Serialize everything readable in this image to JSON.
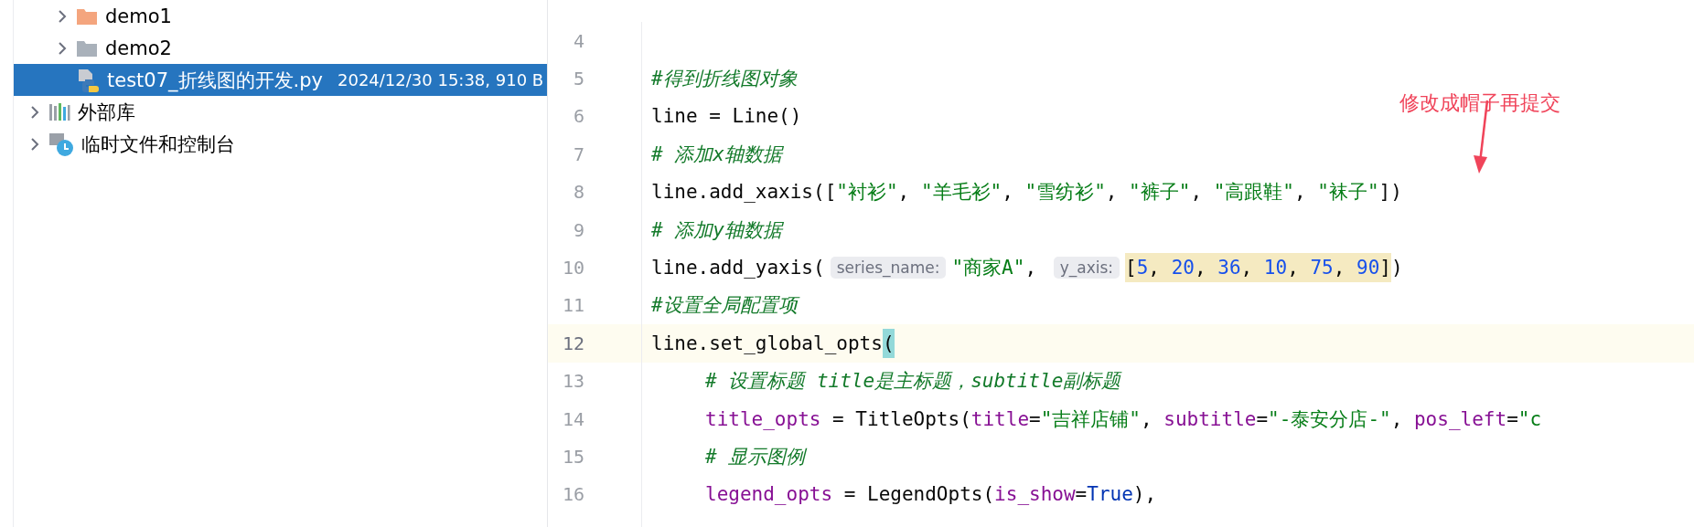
{
  "project_tree": {
    "nested_items": [
      {
        "label": "demo1",
        "kind": "folder",
        "color": "#f4a57e",
        "expanded": false,
        "selected": false
      },
      {
        "label": "demo2",
        "kind": "folder",
        "color": "#a9b1ba",
        "expanded": false,
        "selected": false
      },
      {
        "label": "test07_折线图的开发.py",
        "kind": "python-file",
        "meta": "2024/12/30 15:38, 910 B",
        "selected": true
      }
    ],
    "items": [
      {
        "label": "外部库",
        "kind": "library",
        "expanded": false,
        "selected": false
      },
      {
        "label": "临时文件和控制台",
        "kind": "scratch",
        "expanded": false,
        "selected": false
      }
    ]
  },
  "editor": {
    "lines": [
      {
        "number": "4",
        "current": false
      },
      {
        "number": "5",
        "current": false,
        "tokens": [
          {
            "kind": "comment",
            "text": "#得到折线图对象"
          }
        ]
      },
      {
        "number": "6",
        "current": false,
        "tokens": [
          {
            "kind": "plain",
            "text": "line = Line()"
          }
        ]
      },
      {
        "number": "7",
        "current": false,
        "tokens": [
          {
            "kind": "comment",
            "text": "# 添加x轴数据"
          }
        ]
      },
      {
        "number": "8",
        "current": false,
        "tokens": [
          {
            "kind": "plain",
            "text": "line.add_xaxis(["
          },
          {
            "kind": "string",
            "text": "\"衬衫\""
          },
          {
            "kind": "plain",
            "text": ", "
          },
          {
            "kind": "string",
            "text": "\"羊毛衫\""
          },
          {
            "kind": "plain",
            "text": ", "
          },
          {
            "kind": "string",
            "text": "\"雪纺衫\""
          },
          {
            "kind": "plain",
            "text": ", "
          },
          {
            "kind": "string",
            "text": "\"裤子\""
          },
          {
            "kind": "plain",
            "text": ", "
          },
          {
            "kind": "string",
            "text": "\"高跟鞋\""
          },
          {
            "kind": "plain",
            "text": ", "
          },
          {
            "kind": "string",
            "text": "\"袜子\""
          },
          {
            "kind": "plain",
            "text": "])"
          }
        ]
      },
      {
        "number": "9",
        "current": false,
        "tokens": [
          {
            "kind": "comment",
            "text": "# 添加y轴数据"
          }
        ]
      },
      {
        "number": "10",
        "current": false,
        "tokens": [
          {
            "kind": "plain",
            "text": "line.add_yaxis("
          },
          {
            "kind": "hint",
            "text": "series_name:"
          },
          {
            "kind": "string",
            "text": "\"商家A\""
          },
          {
            "kind": "plain",
            "text": ", "
          },
          {
            "kind": "hint",
            "text": "y_axis:"
          },
          {
            "kind": "selection",
            "tokens": [
              {
                "kind": "plain",
                "text": "["
              },
              {
                "kind": "number",
                "text": "5"
              },
              {
                "kind": "plain",
                "text": ", "
              },
              {
                "kind": "number",
                "text": "20"
              },
              {
                "kind": "plain",
                "text": ", "
              },
              {
                "kind": "number",
                "text": "36"
              },
              {
                "kind": "plain",
                "text": ", "
              },
              {
                "kind": "number",
                "text": "10"
              },
              {
                "kind": "plain",
                "text": ", "
              },
              {
                "kind": "number",
                "text": "75"
              },
              {
                "kind": "plain",
                "text": ", "
              },
              {
                "kind": "number",
                "text": "90"
              },
              {
                "kind": "plain",
                "text": "]"
              }
            ]
          },
          {
            "kind": "plain",
            "text": ")"
          }
        ]
      },
      {
        "number": "11",
        "current": false,
        "tokens": [
          {
            "kind": "comment",
            "text": "#设置全局配置项"
          }
        ]
      },
      {
        "number": "12",
        "current": true,
        "tokens": [
          {
            "kind": "plain",
            "text": "line.set_global_opts"
          },
          {
            "kind": "matched-paren",
            "text": "("
          }
        ],
        "children": [
          {
            "number": "13",
            "current": false,
            "tokens": [
              {
                "kind": "comment",
                "text": "# 设置标题 title是主标题，subtitle副标题"
              }
            ]
          },
          {
            "number": "14",
            "current": false,
            "tokens": [
              {
                "kind": "param",
                "text": "title_opts"
              },
              {
                "kind": "plain",
                "text": " = TitleOpts("
              },
              {
                "kind": "param",
                "text": "title"
              },
              {
                "kind": "plain",
                "text": "="
              },
              {
                "kind": "string",
                "text": "\"吉祥店铺\""
              },
              {
                "kind": "plain",
                "text": ", "
              },
              {
                "kind": "param",
                "text": "subtitle"
              },
              {
                "kind": "plain",
                "text": "="
              },
              {
                "kind": "string",
                "text": "\"-泰安分店-\""
              },
              {
                "kind": "plain",
                "text": ", "
              },
              {
                "kind": "param",
                "text": "pos_left"
              },
              {
                "kind": "plain",
                "text": "="
              },
              {
                "kind": "string",
                "text": "\"c"
              }
            ]
          },
          {
            "number": "15",
            "current": false,
            "tokens": [
              {
                "kind": "comment",
                "text": "# 显示图例"
              }
            ]
          },
          {
            "number": "16",
            "current": false,
            "tokens": [
              {
                "kind": "param",
                "text": "legend_opts"
              },
              {
                "kind": "plain",
                "text": " = LegendOpts("
              },
              {
                "kind": "param",
                "text": "is_show"
              },
              {
                "kind": "plain",
                "text": "="
              },
              {
                "kind": "builtin",
                "text": "True"
              },
              {
                "kind": "plain",
                "text": "),"
              }
            ]
          }
        ]
      }
    ]
  },
  "annotation": {
    "text": "修改成帽子再提交"
  }
}
